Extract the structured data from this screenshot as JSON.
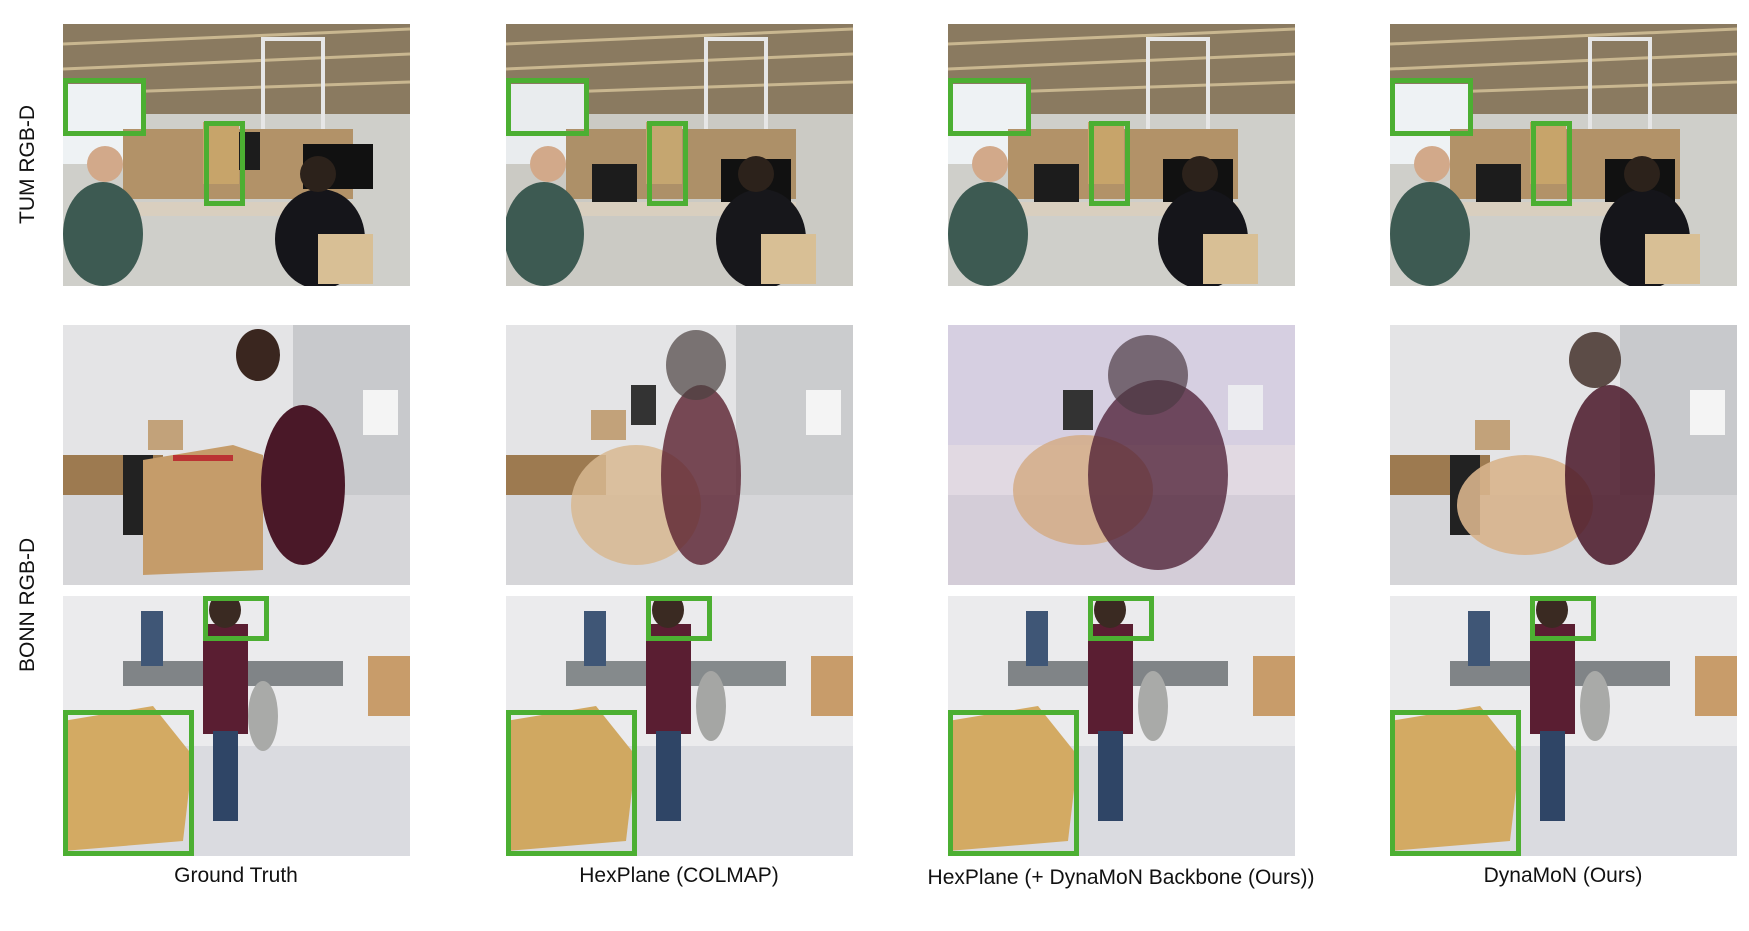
{
  "rows": {
    "tum": "TUM RGB-D",
    "bonn": "BONN RGB-D"
  },
  "columns": [
    "Ground Truth",
    "HexPlane (COLMAP)",
    "HexPlane (+  DynaMoN Backbone (Ours))",
    "DynaMoN (Ours)"
  ],
  "colors": {
    "highlight_box": "#4caf32"
  }
}
